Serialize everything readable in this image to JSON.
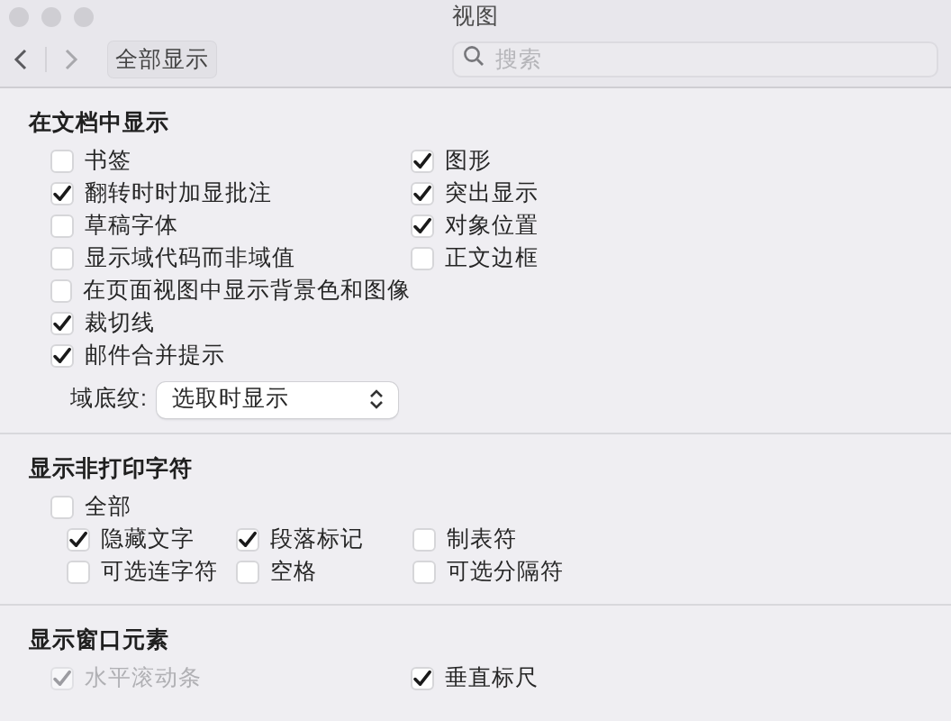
{
  "window": {
    "title": "视图"
  },
  "toolbar": {
    "show_all": "全部显示",
    "search": {
      "placeholder": "搜索"
    }
  },
  "sections": [
    {
      "title": "在文档中显示",
      "columns": [
        [
          {
            "label": "书签",
            "checked": false,
            "disabled": false
          },
          {
            "label": "翻转时时加显批注",
            "checked": true,
            "disabled": false
          },
          {
            "label": "草稿字体",
            "checked": false,
            "disabled": false
          },
          {
            "label": "显示域代码而非域值",
            "checked": false,
            "disabled": false
          },
          {
            "label": "在页面视图中显示背景色和图像",
            "checked": false,
            "disabled": false
          },
          {
            "label": "裁切线",
            "checked": true,
            "disabled": false
          },
          {
            "label": "邮件合并提示",
            "checked": true,
            "disabled": false
          }
        ],
        [
          {
            "label": "图形",
            "checked": true,
            "disabled": false
          },
          {
            "label": "突出显示",
            "checked": true,
            "disabled": false
          },
          {
            "label": "对象位置",
            "checked": true,
            "disabled": false
          },
          {
            "label": "正文边框",
            "checked": false,
            "disabled": false
          }
        ]
      ],
      "field": {
        "label": "域底纹:",
        "value": "选取时显示"
      }
    },
    {
      "title": "显示非打印字符",
      "all": {
        "label": "全部",
        "checked": false,
        "disabled": false
      },
      "grid": [
        {
          "label": "隐藏文字",
          "checked": true,
          "disabled": false
        },
        {
          "label": "段落标记",
          "checked": true,
          "disabled": false
        },
        {
          "label": "制表符",
          "checked": false,
          "disabled": false
        },
        {
          "label": "可选连字符",
          "checked": false,
          "disabled": false
        },
        {
          "label": "空格",
          "checked": false,
          "disabled": false
        },
        {
          "label": "可选分隔符",
          "checked": false,
          "disabled": false
        }
      ]
    },
    {
      "title": "显示窗口元素",
      "columns": [
        [
          {
            "label": "水平滚动条",
            "checked": true,
            "disabled": true
          }
        ],
        [
          {
            "label": "垂直标尺",
            "checked": true,
            "disabled": false
          }
        ]
      ]
    }
  ]
}
